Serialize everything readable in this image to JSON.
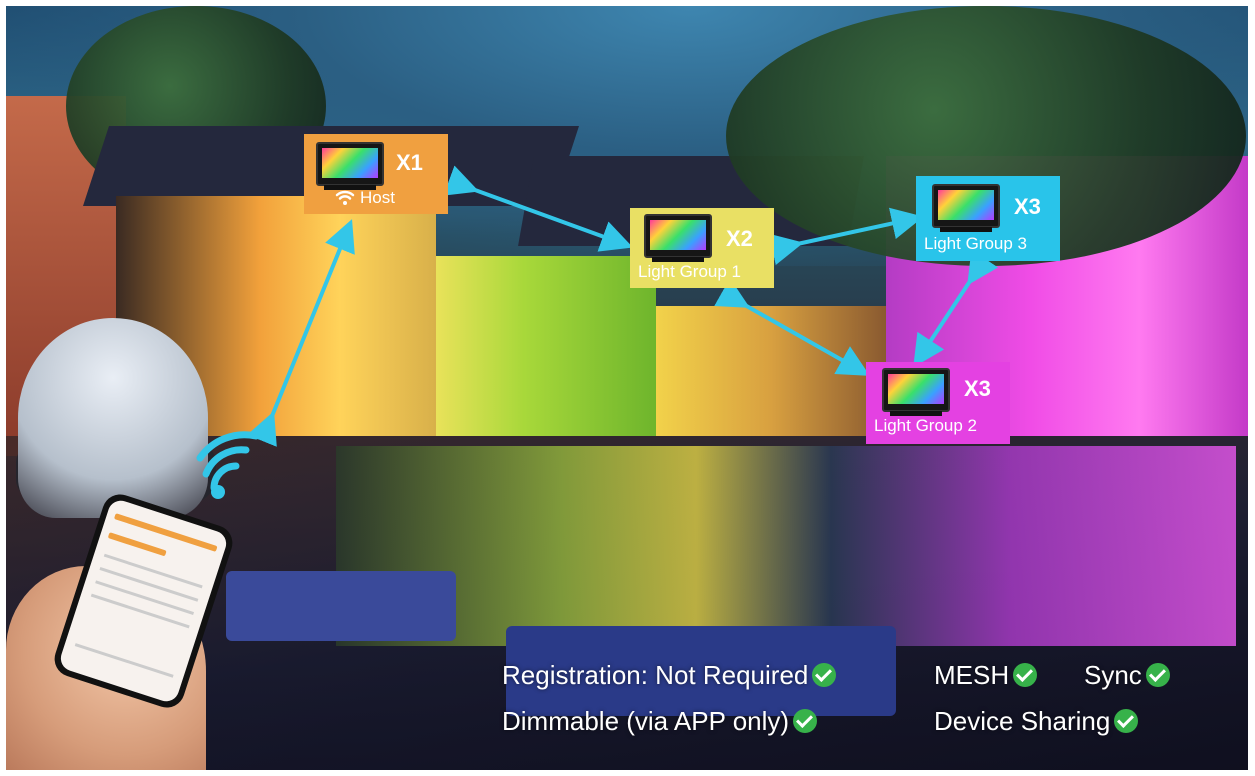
{
  "callouts": {
    "x1": {
      "count": "X1",
      "label": "Host",
      "icon": "wifi-icon",
      "color": "#f0a040"
    },
    "x2": {
      "count": "X2",
      "label": "Light Group 1",
      "color": "#e9e064"
    },
    "x3_group3": {
      "count": "X3",
      "label": "Light Group 3",
      "color": "#29c4ea"
    },
    "x3_group2": {
      "count": "X3",
      "label": "Light Group 2",
      "color": "#e441e2"
    }
  },
  "connector_color": "#33c6e8",
  "features": [
    {
      "text": "Registration: Not Required"
    },
    {
      "text": "MESH"
    },
    {
      "text": "Sync"
    },
    {
      "text": "Dimmable (via APP only)"
    },
    {
      "text": "Device Sharing"
    }
  ],
  "check_color": "#37b24a"
}
